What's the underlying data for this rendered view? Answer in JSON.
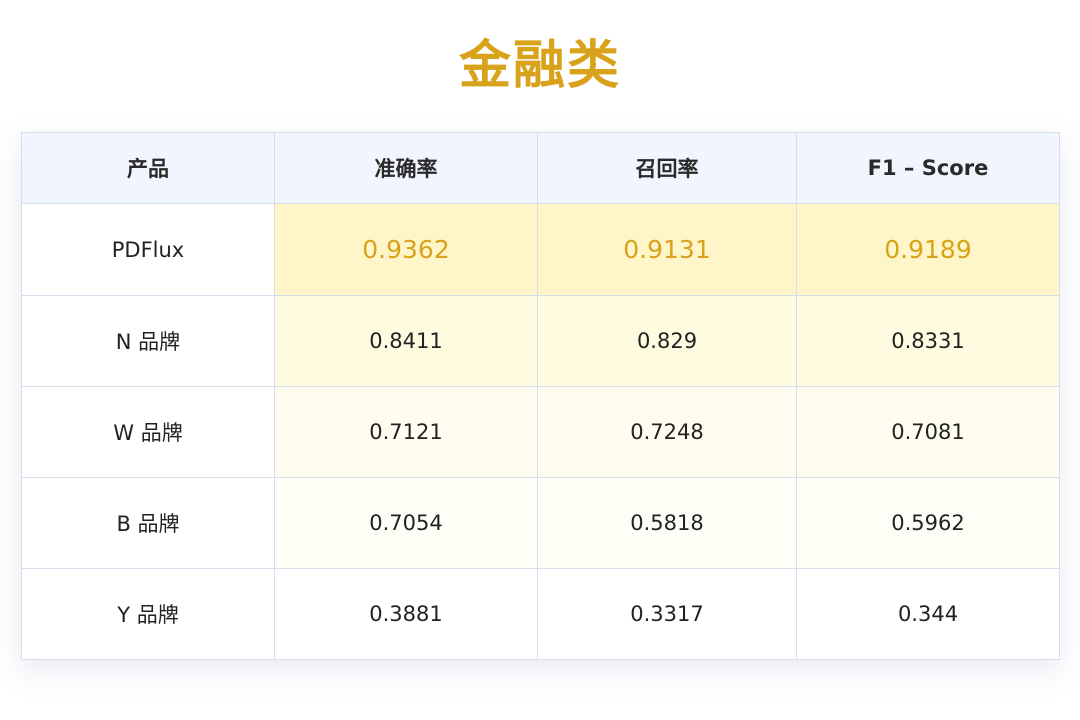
{
  "title": "金融类",
  "colors": {
    "accent": "#D9A21B",
    "header_bg": "#F1F5FD",
    "border": "#D6DEEB",
    "highlight_row_bg": "#FEF6C9"
  },
  "table": {
    "headers": [
      "产品",
      "准确率",
      "召回率",
      "F1 – Score"
    ],
    "rows": [
      {
        "name": "PDFlux",
        "values": [
          "0.9362",
          "0.9131",
          "0.9189"
        ]
      },
      {
        "name": "N 品牌",
        "values": [
          "0.8411",
          "0.829",
          "0.8331"
        ]
      },
      {
        "name": "W 品牌",
        "values": [
          "0.7121",
          "0.7248",
          "0.7081"
        ]
      },
      {
        "name": "B 品牌",
        "values": [
          "0.7054",
          "0.5818",
          "0.5962"
        ]
      },
      {
        "name": "Y 品牌",
        "values": [
          "0.3881",
          "0.3317",
          "0.344"
        ]
      }
    ]
  }
}
